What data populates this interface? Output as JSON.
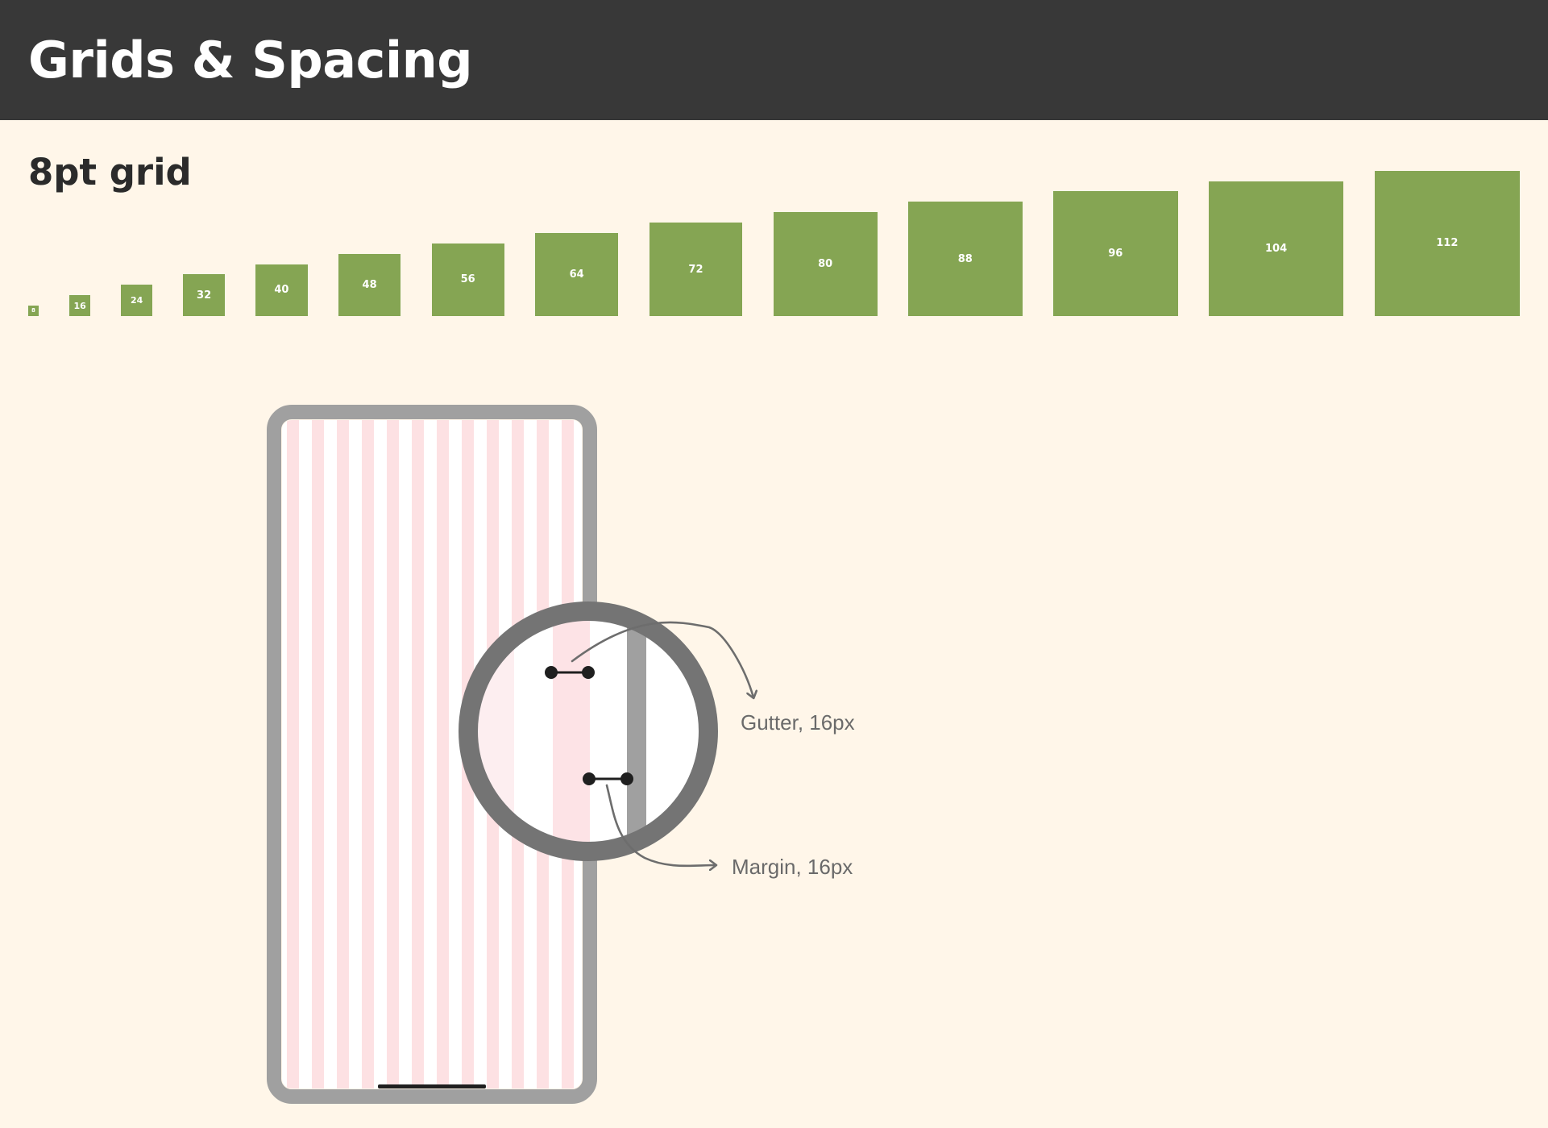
{
  "header": {
    "title": "Grids & Spacing"
  },
  "section": {
    "title": "8pt grid"
  },
  "spacing_scale": {
    "unit": "px",
    "values": [
      8,
      16,
      24,
      32,
      40,
      48,
      56,
      64,
      72,
      80,
      88,
      96,
      104,
      112
    ],
    "labels": [
      "8",
      "16",
      "24",
      "32",
      "40",
      "48",
      "56",
      "64",
      "72",
      "80",
      "88",
      "96",
      "104",
      "112"
    ]
  },
  "phone_diagram": {
    "gutter_label": "Gutter, 16px",
    "margin_label": "Margin, 16px"
  },
  "colors": {
    "header_bg": "#383838",
    "page_bg": "#fff6e9",
    "square_fill": "#85a553",
    "column_fill": "#fde1e3",
    "frame": "#a0a0a0",
    "magnifier_ring": "#747474",
    "marker": "#1f1f1f"
  }
}
